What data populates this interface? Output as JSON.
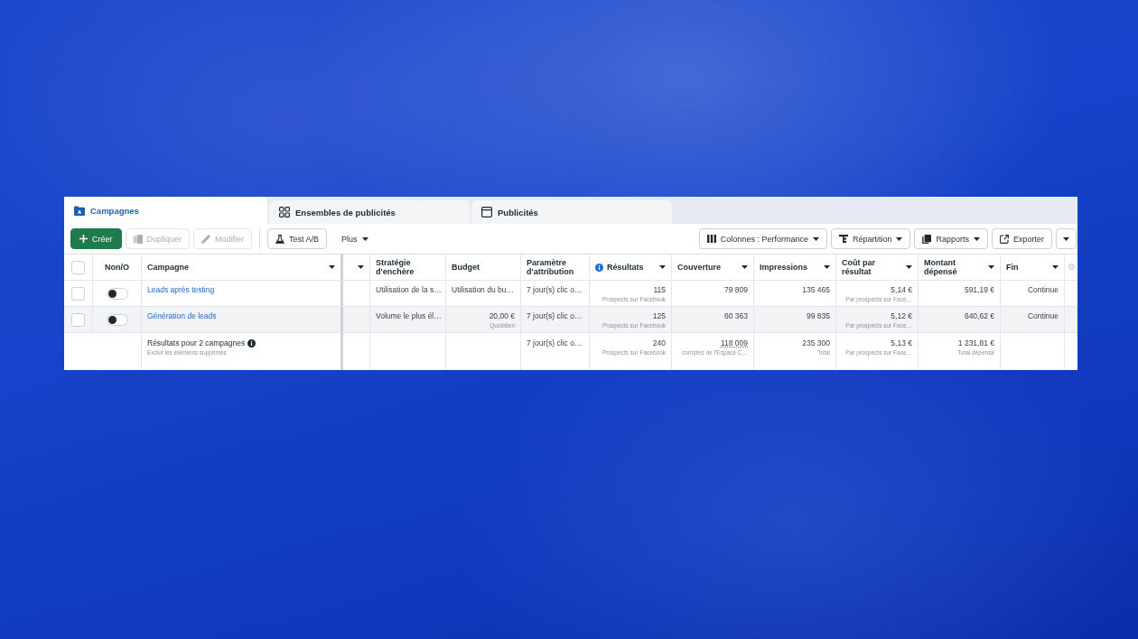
{
  "tabs": [
    {
      "label": "Campagnes",
      "selected": true
    },
    {
      "label": "Ensembles de publicités",
      "selected": false
    },
    {
      "label": "Publicités",
      "selected": false
    }
  ],
  "toolbar": {
    "left": [
      {
        "label": "Créer",
        "kind": "primary",
        "disabled": false
      },
      {
        "label": "Dupliquer",
        "kind": "button",
        "disabled": true
      },
      {
        "label": "Modifier",
        "kind": "button",
        "disabled": true
      },
      {
        "label": "Test A/B",
        "kind": "button",
        "disabled": false
      },
      {
        "label": "Plus",
        "kind": "menu",
        "disabled": false
      }
    ],
    "right": [
      {
        "label": "Colonnes : Performance",
        "kind": "dropdown",
        "disabled": false
      },
      {
        "label": "Répartition",
        "kind": "dropdown",
        "disabled": false
      },
      {
        "label": "Rapports",
        "kind": "dropdown",
        "disabled": false
      },
      {
        "label": "Exporter",
        "kind": "split",
        "disabled": false
      }
    ]
  },
  "table": {
    "select_all": {
      "checked": false
    },
    "toggle_column": "Non/O",
    "columns": [
      {
        "label": "Campagne",
        "caret": true
      },
      {
        "caret": true
      },
      {
        "label": "Stratégie d'enchère",
        "caret": false
      },
      {
        "label": "Budget",
        "caret": false
      },
      {
        "label": "Paramètre d'attribution",
        "caret": false
      },
      {
        "label": "Résultats",
        "caret": true,
        "info": true
      },
      {
        "label": "Couverture",
        "caret": true
      },
      {
        "label": "Impressions",
        "caret": true
      },
      {
        "label": "Coût par résultat",
        "caret": true
      },
      {
        "label": "Montant dépensé",
        "caret": true
      },
      {
        "label": "Fin",
        "caret": true
      }
    ],
    "rows": [
      {
        "checked": false,
        "on": false,
        "highlighted": false,
        "cells": [
          {
            "kind": "link",
            "text": "Leads après testing"
          },
          null,
          {
            "kind": "text",
            "text": "Utilisation de la s…"
          },
          {
            "kind": "text",
            "text": "Utilisation du bu…"
          },
          {
            "kind": "text",
            "text": "7 jour(s) clic o…"
          },
          {
            "kind": "number",
            "text": "115",
            "note": "Prospects sur Facebook"
          },
          {
            "kind": "number",
            "text": "79 809"
          },
          {
            "kind": "number",
            "text": "135 465"
          },
          {
            "kind": "number",
            "text": "5,14 €",
            "note": "Par prospects sur Face…"
          },
          {
            "kind": "number",
            "text": "591,19 €"
          },
          {
            "kind": "number",
            "text": "Continue"
          }
        ]
      },
      {
        "checked": false,
        "on": false,
        "highlighted": true,
        "cells": [
          {
            "kind": "link",
            "text": "Génération de leads"
          },
          null,
          {
            "kind": "text",
            "text": "Volume le plus él…"
          },
          {
            "kind": "number",
            "text": "20,00 €",
            "note": "Quotidien"
          },
          {
            "kind": "text",
            "text": "7 jour(s) clic o…"
          },
          {
            "kind": "number",
            "text": "125",
            "note": "Prospects sur Facebook"
          },
          {
            "kind": "number",
            "text": "60 363"
          },
          {
            "kind": "number",
            "text": "99 835"
          },
          {
            "kind": "number",
            "text": "5,12 €",
            "note": "Par prospects sur Face…"
          },
          {
            "kind": "number",
            "text": "640,62 €"
          },
          {
            "kind": "number",
            "text": "Continue"
          }
        ]
      }
    ],
    "summary": {
      "cells": [
        {
          "kind": "summary",
          "text": "Résultats pour 2 campagnes",
          "info": true,
          "note": "Exclut les éléments supprimés"
        },
        null,
        null,
        null,
        {
          "kind": "text",
          "text": "7 jour(s) clic o…"
        },
        {
          "kind": "number",
          "text": "240",
          "note": "Prospects sur Facebook"
        },
        {
          "kind": "number",
          "text": "118 009",
          "note": "comptes de l'Espace C…",
          "underline": true
        },
        {
          "kind": "number",
          "text": "235 300",
          "note": "Total"
        },
        {
          "kind": "number",
          "text": "5,13 €",
          "note": "Par prospects sur Face…"
        },
        {
          "kind": "number",
          "text": "1 231,81 €",
          "note": "Total dépensé"
        },
        null
      ]
    }
  }
}
